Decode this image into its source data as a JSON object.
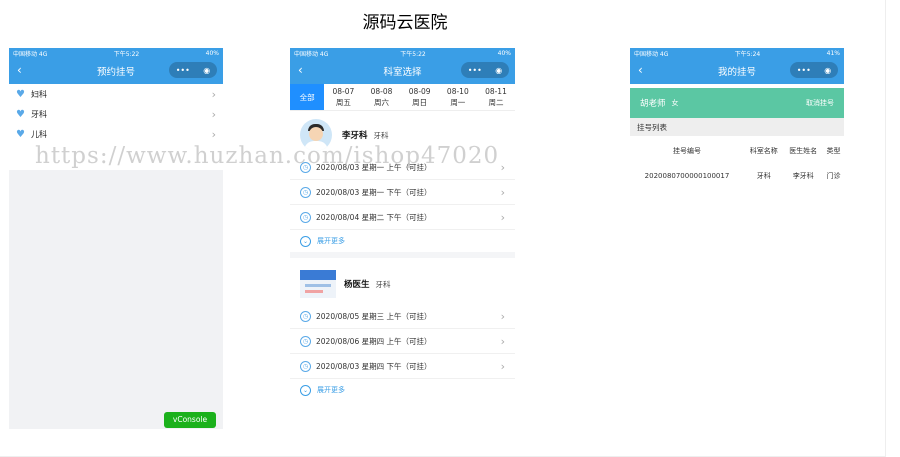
{
  "page_title": "源码云医院",
  "watermark": "https://www.huzhan.com/ishop47020",
  "colors": {
    "nav_blue": "#3a9ee6",
    "tab_active": "#1f8fff",
    "user_bar": "#5bc7a3",
    "vconsole": "#1bb11b"
  },
  "phone1": {
    "status": {
      "carrier": "中国移动 4G",
      "time": "下午5:22",
      "battery": "40%"
    },
    "nav_title": "预约挂号",
    "items": [
      {
        "label": "妇科",
        "icon": "heart-icon"
      },
      {
        "label": "牙科",
        "icon": "heart-icon"
      },
      {
        "label": "儿科",
        "icon": "heart-icon"
      }
    ],
    "vconsole": "vConsole"
  },
  "phone2": {
    "status": {
      "carrier": "中国移动 4G",
      "time": "下午5:22",
      "battery": "40%"
    },
    "nav_title": "科室选择",
    "tabs": [
      {
        "date": "全部",
        "weekday": ""
      },
      {
        "date": "08-07",
        "weekday": "周五"
      },
      {
        "date": "08-08",
        "weekday": "周六"
      },
      {
        "date": "08-09",
        "weekday": "周日"
      },
      {
        "date": "08-10",
        "weekday": "周一"
      },
      {
        "date": "08-11",
        "weekday": "周二"
      }
    ],
    "doctors": [
      {
        "name": "李牙科",
        "dept": "牙科",
        "slots": [
          "2020/08/03 星期一 上午（可挂）",
          "2020/08/03 星期一 下午（可挂）",
          "2020/08/04 星期二 下午（可挂）"
        ]
      },
      {
        "name": "杨医生",
        "dept": "牙科",
        "slots": [
          "2020/08/05 星期三 上午（可挂）",
          "2020/08/06 星期四 上午（可挂）",
          "2020/08/03 星期四 下午（可挂）"
        ]
      }
    ],
    "expand_label": "展开更多"
  },
  "phone3": {
    "status": {
      "carrier": "中国移动 4G",
      "time": "下午5:24",
      "battery": "41%"
    },
    "nav_title": "我的挂号",
    "user": {
      "name": "胡老师",
      "gender": "女",
      "link": "取消挂号"
    },
    "section": "挂号列表",
    "headers": [
      "挂号编号",
      "科室名称",
      "医生姓名",
      "类型"
    ],
    "rows": [
      [
        "2020080700000100017",
        "牙科",
        "李牙科",
        "门诊"
      ]
    ]
  }
}
